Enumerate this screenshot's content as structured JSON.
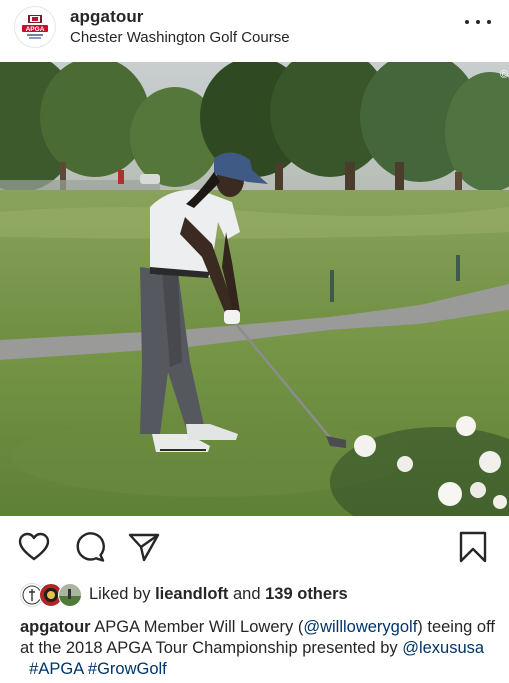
{
  "post": {
    "author": "apgatour",
    "location": "Chester Washington Golf Course",
    "avatar_logo_text": "APGA",
    "photo_description": "golfer-address-iron",
    "photo_watermark": "©"
  },
  "actions": {
    "like_icon": "heart-icon",
    "comment_icon": "comment-icon",
    "share_icon": "paper-plane-icon",
    "save_icon": "bookmark-icon"
  },
  "likes": {
    "prefix": "Liked by",
    "first_user": "lieandloft",
    "middle": "and",
    "others": "139 others"
  },
  "caption": {
    "author": "apgatour",
    "text_1": " APGA Member Will Lowery (",
    "mention_1": "@willlowerygolf",
    "text_2": ") teeing off at the 2018 APGA Tour Championship presented by ",
    "mention_2": "@lexususa",
    "text_3": "  ",
    "hashtag_1": "#APGA",
    "text_4": " ",
    "hashtag_2": "#GrowGolf"
  },
  "colors": {
    "text": "#262626",
    "link": "#003569",
    "logo_red": "#c8102e"
  }
}
